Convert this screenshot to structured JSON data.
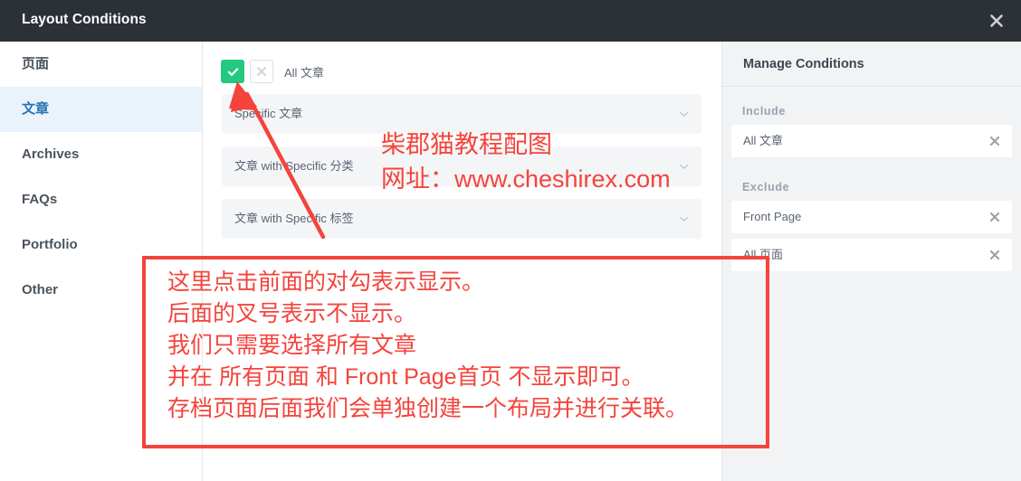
{
  "header": {
    "title": "Layout Conditions",
    "close_icon": "close-icon",
    "bg": "#2c3138"
  },
  "sidebar": {
    "items": [
      {
        "label": "页面",
        "active": false
      },
      {
        "label": "文章",
        "active": true
      },
      {
        "label": "Archives",
        "active": false
      },
      {
        "label": "FAQs",
        "active": false
      },
      {
        "label": "Portfolio",
        "active": false
      },
      {
        "label": "Other",
        "active": false
      }
    ],
    "active_color": "#2472b3",
    "active_bg": "#eaf3fb"
  },
  "content": {
    "toggle_row": {
      "include_icon": "check-icon",
      "exclude_icon": "cross-icon",
      "include_state": "on",
      "exclude_state": "off",
      "label": "All 文章",
      "include_color": "#23c97f"
    },
    "dropdowns": [
      {
        "label": "Specific 文章",
        "caret_icon": "chevron-down-icon"
      },
      {
        "label": "文章 with Specific 分类",
        "caret_icon": "chevron-down-icon"
      },
      {
        "label": "文章 with Specific 标签",
        "caret_icon": "chevron-down-icon"
      }
    ]
  },
  "right_panel": {
    "title": "Manage Conditions",
    "groups": [
      {
        "title": "Include",
        "items": [
          {
            "label": "All 文章",
            "remove_icon": "close-icon"
          }
        ]
      },
      {
        "title": "Exclude",
        "items": [
          {
            "label": "Front Page",
            "remove_icon": "close-icon"
          },
          {
            "label": "All 页面",
            "remove_icon": "close-icon"
          }
        ]
      }
    ]
  },
  "annotations": {
    "color": "#f4443c",
    "watermark": [
      "柴郡猫教程配图",
      "网址：www.cheshirex.com"
    ],
    "callout_box": [
      "这里点击前面的对勾表示显示。",
      "后面的叉号表示不显示。",
      "我们只需要选择所有文章",
      "并在 所有页面 和 Front Page首页 不显示即可。",
      "存档页面后面我们会单独创建一个布局并进行关联。"
    ],
    "arrow": "red-arrow-pointing-to-check-toggle"
  }
}
